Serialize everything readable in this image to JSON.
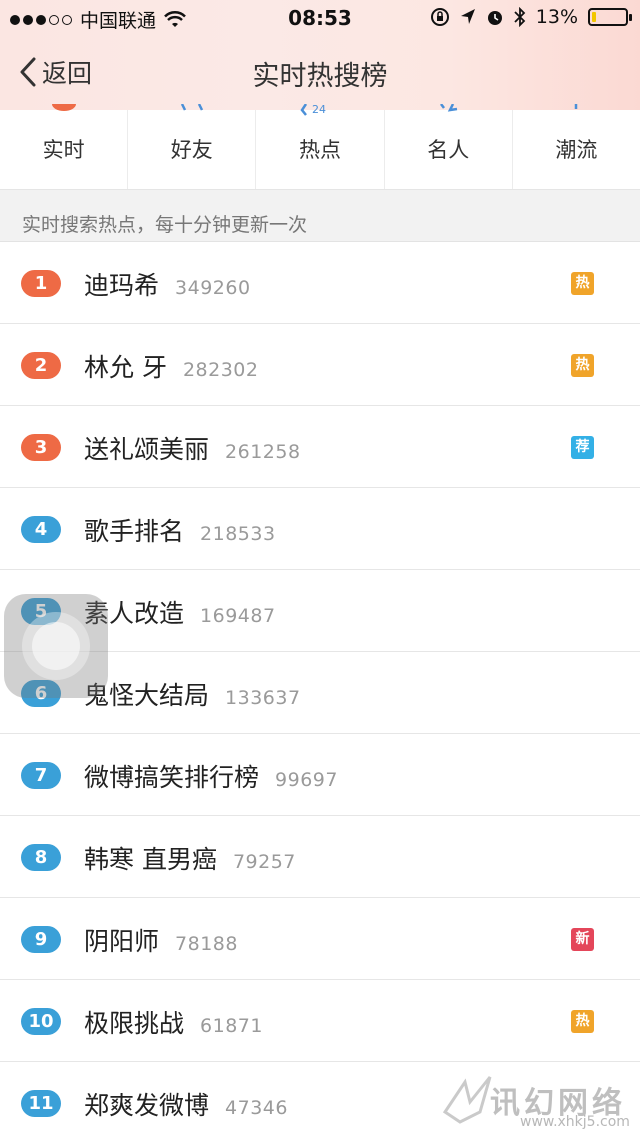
{
  "status_bar": {
    "carrier": "中国联通",
    "time": "08:53",
    "battery_percent": "13%",
    "battery_level": 0.13,
    "icons": [
      "signal-dots",
      "wifi-icon",
      "rotation-lock-icon",
      "location-icon",
      "alarm-icon",
      "bluetooth-icon",
      "battery-icon"
    ]
  },
  "nav": {
    "back_label": "返回",
    "title": "实时热搜榜"
  },
  "tabs": [
    {
      "label": "实时",
      "active": true
    },
    {
      "label": "好友"
    },
    {
      "label": "热点"
    },
    {
      "label": "名人"
    },
    {
      "label": "潮流"
    }
  ],
  "subtitle": "实时搜索热点，每十分钟更新一次",
  "colors": {
    "rank_top": "#ee6a45",
    "rank_other": "#3aa0d8",
    "badge_hot": "#f0a42a",
    "badge_recommend": "#33b0e6",
    "badge_new": "#e4465a"
  },
  "list": [
    {
      "rank": "1",
      "keyword": "迪玛希",
      "count": "349260",
      "badge": "热",
      "badge_type": "hot",
      "rank_type": "top"
    },
    {
      "rank": "2",
      "keyword": "林允 牙",
      "count": "282302",
      "badge": "热",
      "badge_type": "hot",
      "rank_type": "top"
    },
    {
      "rank": "3",
      "keyword": "送礼颂美丽",
      "count": "261258",
      "badge": "荐",
      "badge_type": "recommend",
      "rank_type": "top"
    },
    {
      "rank": "4",
      "keyword": "歌手排名",
      "count": "218533",
      "badge": "",
      "rank_type": "other"
    },
    {
      "rank": "5",
      "keyword": "素人改造",
      "count": "169487",
      "badge": "",
      "rank_type": "other"
    },
    {
      "rank": "6",
      "keyword": "鬼怪大结局",
      "count": "133637",
      "badge": "",
      "rank_type": "other"
    },
    {
      "rank": "7",
      "keyword": "微博搞笑排行榜",
      "count": "99697",
      "badge": "",
      "rank_type": "other"
    },
    {
      "rank": "8",
      "keyword": "韩寒 直男癌",
      "count": "79257",
      "badge": "",
      "rank_type": "other"
    },
    {
      "rank": "9",
      "keyword": "阴阳师",
      "count": "78188",
      "badge": "新",
      "badge_type": "new",
      "rank_type": "other"
    },
    {
      "rank": "10",
      "keyword": "极限挑战",
      "count": "61871",
      "badge": "热",
      "badge_type": "hot",
      "rank_type": "other"
    },
    {
      "rank": "11",
      "keyword": "郑爽发微博",
      "count": "47346",
      "badge": "",
      "rank_type": "other"
    }
  ],
  "watermark": {
    "text": "讯幻网络",
    "url": "www.xhkj5.com"
  }
}
